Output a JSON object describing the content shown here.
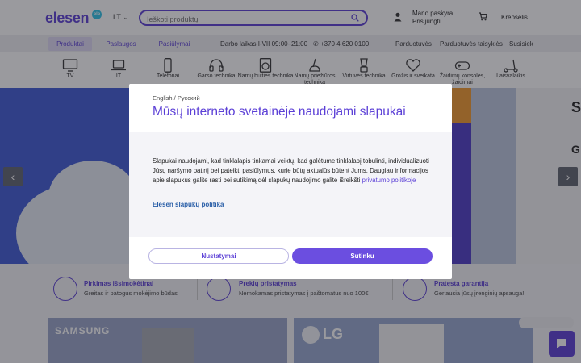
{
  "header": {
    "logo": "elesen",
    "logo_badge": "ele",
    "language": "LT",
    "search_placeholder": "Ieškoti produktų",
    "account_line1": "Mano paskyra",
    "account_line2": "Prisijungti",
    "cart": "Krepšelis"
  },
  "nav": {
    "tabs": [
      "Produktai",
      "Paslaugos",
      "Pasiūlymai"
    ],
    "hours": "Darbo laikas I-VII 09:00–21:00",
    "phone": "+370 4 620 0100",
    "links": [
      "Parduotuvės",
      "Parduotuvės taisyklės",
      "Susisiek"
    ]
  },
  "categories": [
    {
      "label": "TV",
      "icon": "tv-icon"
    },
    {
      "label": "IT",
      "icon": "laptop-icon"
    },
    {
      "label": "Telefonai",
      "icon": "phone-icon"
    },
    {
      "label": "Garso technika",
      "icon": "headphones-icon"
    },
    {
      "label": "Namų buities technika",
      "icon": "washing-machine-icon"
    },
    {
      "label": "Namų priežiūros technika",
      "icon": "vacuum-icon"
    },
    {
      "label": "Virtuvės technika",
      "icon": "blender-icon"
    },
    {
      "label": "Grožis ir sveikata",
      "icon": "heart-icon"
    },
    {
      "label": "Žaidimų konsolės, žaidimai",
      "icon": "gamepad-icon"
    },
    {
      "label": "Laisvalaikis",
      "icon": "scooter-icon"
    }
  ],
  "hero": {
    "right_letter_1": "S",
    "right_letter_2": "G"
  },
  "features": [
    {
      "title": "Pirkimas išsimokėtinai",
      "subtitle": "Greitas ir patogus mokėjimo būdas"
    },
    {
      "title": "Prekių pristatymas",
      "subtitle": "Nemokamas pristatymas į paštomatus nuo 100€"
    },
    {
      "title": "Pratęsta garantija",
      "subtitle": "Geriausia jūsų įrenginių apsauga!"
    }
  ],
  "brands": [
    "SAMSUNG",
    "LG"
  ],
  "cookie_modal": {
    "lang_links": "English / Русский",
    "title": "Mūsų interneto svetainėje naudojami slapukai",
    "body_text": "Slapukai naudojami, kad tinklalapis tinkamai veiktų, kad galėtume tinklalapį tobulinti, individualizuoti Jūsų naršymo patirtį bei pateikti pasiūlymus, kurie būtų aktualūs būtent Jums. Daugiau informacijos apie slapukus galite rasti bei sutikimą dėl slapukų naudojimo galite išreikšti",
    "privacy_link": "privatumo politikoje",
    "policy_link": "Elesen slapukų politika",
    "settings_button": "Nustatymai",
    "accept_button": "Sutinku"
  },
  "colors": {
    "accent": "#5b3fd6",
    "hero_blue": "#3f5ad6",
    "overlay": "rgba(30,30,40,0.45)"
  }
}
